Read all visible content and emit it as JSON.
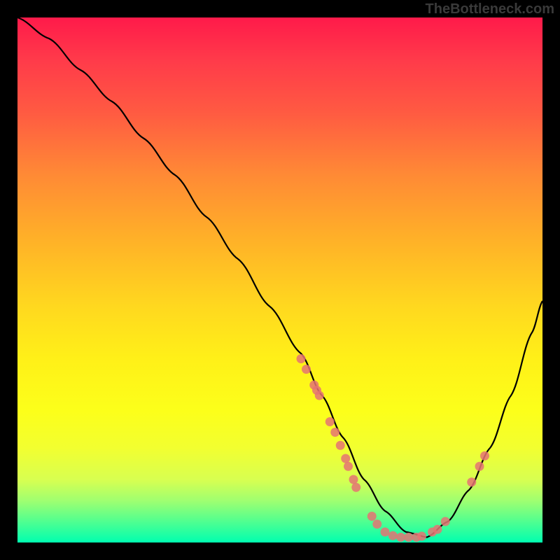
{
  "watermark": "TheBottleneck.com",
  "chart_data": {
    "type": "line",
    "title": "",
    "xlabel": "",
    "ylabel": "",
    "xlim": [
      0,
      100
    ],
    "ylim": [
      0,
      100
    ],
    "curve": {
      "x": [
        0,
        6,
        12,
        18,
        24,
        30,
        36,
        42,
        48,
        54,
        58,
        62,
        66,
        70,
        74,
        78,
        82,
        86,
        90,
        94,
        98,
        100
      ],
      "y": [
        100,
        96,
        90,
        84,
        77,
        70,
        62,
        54,
        45,
        36,
        28,
        20,
        12,
        6,
        2,
        1,
        4,
        10,
        18,
        28,
        40,
        46
      ]
    },
    "points": [
      {
        "x": 54.0,
        "y": 35.0
      },
      {
        "x": 55.0,
        "y": 33.0
      },
      {
        "x": 56.5,
        "y": 30.0
      },
      {
        "x": 57.0,
        "y": 29.0
      },
      {
        "x": 57.5,
        "y": 28.0
      },
      {
        "x": 59.5,
        "y": 23.0
      },
      {
        "x": 60.5,
        "y": 21.0
      },
      {
        "x": 61.5,
        "y": 18.5
      },
      {
        "x": 62.5,
        "y": 16.0
      },
      {
        "x": 63.0,
        "y": 14.5
      },
      {
        "x": 64.0,
        "y": 12.0
      },
      {
        "x": 64.5,
        "y": 10.5
      },
      {
        "x": 67.5,
        "y": 5.0
      },
      {
        "x": 68.5,
        "y": 3.5
      },
      {
        "x": 70.0,
        "y": 2.0
      },
      {
        "x": 71.5,
        "y": 1.3
      },
      {
        "x": 73.0,
        "y": 1.0
      },
      {
        "x": 74.5,
        "y": 1.0
      },
      {
        "x": 76.0,
        "y": 1.0
      },
      {
        "x": 77.0,
        "y": 1.2
      },
      {
        "x": 79.0,
        "y": 2.0
      },
      {
        "x": 80.0,
        "y": 2.5
      },
      {
        "x": 81.5,
        "y": 4.0
      },
      {
        "x": 86.5,
        "y": 11.5
      },
      {
        "x": 88.0,
        "y": 14.5
      },
      {
        "x": 89.0,
        "y": 16.5
      }
    ]
  }
}
